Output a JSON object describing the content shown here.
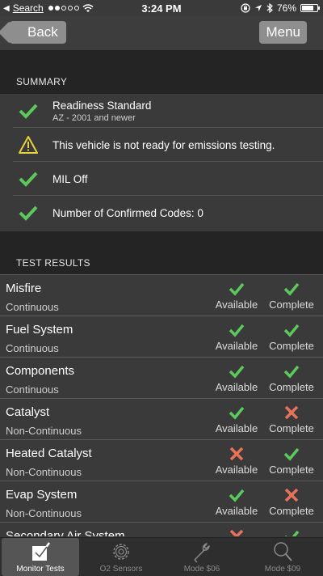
{
  "status_bar": {
    "carrier": "Search",
    "time": "3:24 PM",
    "battery": "76%",
    "battery_level": 0.76
  },
  "nav": {
    "back_label": "Back",
    "menu_label": "Menu"
  },
  "summary": {
    "header": "SUMMARY",
    "items": [
      {
        "icon": "check-icon",
        "title": "Readiness Standard",
        "subtitle": "AZ - 2001 and newer"
      },
      {
        "icon": "warning-icon",
        "title": "This vehicle is not ready for emissions testing.",
        "subtitle": ""
      },
      {
        "icon": "check-icon",
        "title": "MIL Off",
        "subtitle": ""
      },
      {
        "icon": "check-icon",
        "title": "Number of Confirmed Codes: 0",
        "subtitle": ""
      }
    ]
  },
  "tests": {
    "header": "TEST RESULTS",
    "available_label": "Available",
    "complete_label": "Complete",
    "rows": [
      {
        "name": "Misfire",
        "type": "Continuous",
        "available": true,
        "complete": true
      },
      {
        "name": "Fuel System",
        "type": "Continuous",
        "available": true,
        "complete": true
      },
      {
        "name": "Components",
        "type": "Continuous",
        "available": true,
        "complete": true
      },
      {
        "name": "Catalyst",
        "type": "Non-Continuous",
        "available": true,
        "complete": false
      },
      {
        "name": "Heated Catalyst",
        "type": "Non-Continuous",
        "available": false,
        "complete": true
      },
      {
        "name": "Evap System",
        "type": "Non-Continuous",
        "available": true,
        "complete": false
      },
      {
        "name": "Secondary Air System",
        "type": "",
        "available": false,
        "complete": true
      }
    ]
  },
  "tabs": [
    {
      "label": "Monitor Tests",
      "icon": "checkbox-icon",
      "active": true
    },
    {
      "label": "O2 Sensors",
      "icon": "gear-icon",
      "active": false
    },
    {
      "label": "Mode $06",
      "icon": "wrench-icon",
      "active": false
    },
    {
      "label": "Mode $09",
      "icon": "magnifier-icon",
      "active": false
    }
  ],
  "colors": {
    "check": "#5cc95c",
    "cross": "#e8735a",
    "warning": "#e6d23c"
  }
}
